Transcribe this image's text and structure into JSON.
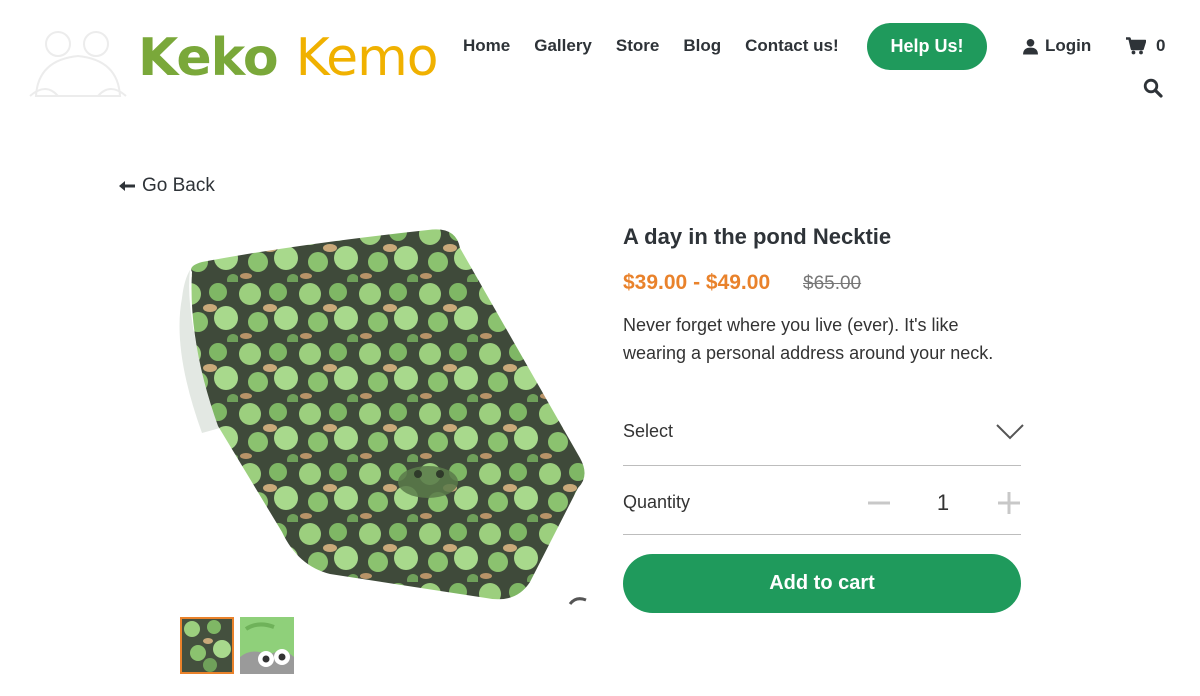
{
  "brand": {
    "part1": "Keko",
    "part2": "Kemo"
  },
  "nav": [
    {
      "label": "Home"
    },
    {
      "label": "Gallery"
    },
    {
      "label": "Store"
    },
    {
      "label": "Blog"
    },
    {
      "label": "Contact us!"
    }
  ],
  "header": {
    "help_label": "Help Us!",
    "login_label": "Login",
    "cart_count": "0"
  },
  "back": {
    "label": "Go Back"
  },
  "product": {
    "title": "A day in the pond Necktie",
    "price": "$39.00 - $49.00",
    "compare_price": "$65.00",
    "description": "Never forget where you live (ever). It's like wearing a personal address around your neck.",
    "select_label": "Select",
    "quantity_label": "Quantity",
    "quantity_value": "1",
    "add_to_cart_label": "Add to cart"
  },
  "colors": {
    "brand_green": "#7aa83a",
    "brand_yellow": "#f0b100",
    "button_green": "#1f9a5c",
    "price_orange": "#e9822b"
  },
  "icons": [
    "frog-logo-icon",
    "user-icon",
    "cart-icon",
    "search-icon",
    "arrow-left-icon",
    "chevron-down-icon",
    "minus-icon",
    "plus-icon"
  ]
}
